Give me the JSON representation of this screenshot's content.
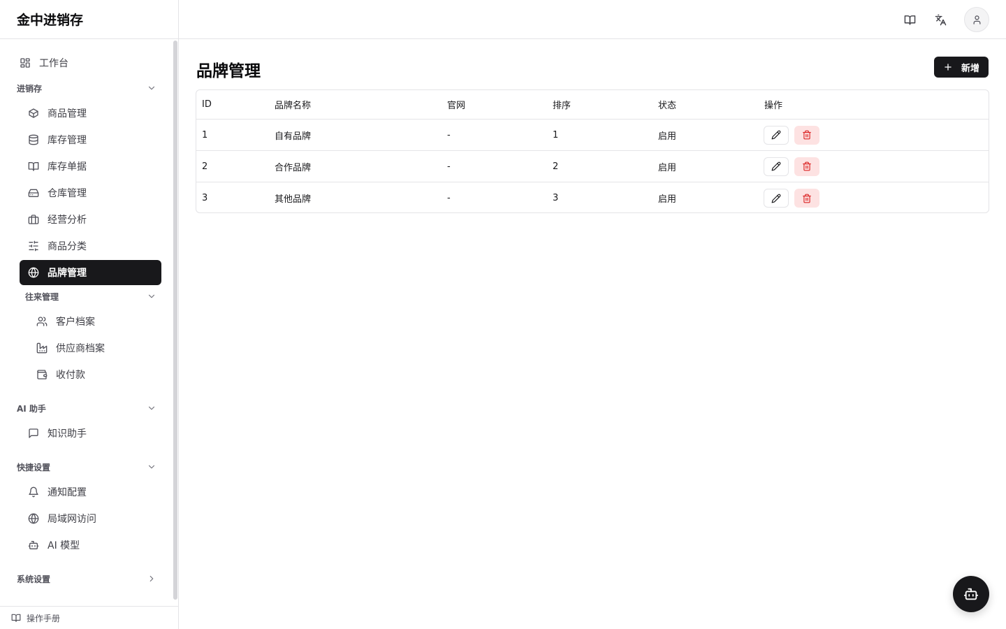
{
  "app": {
    "title": "金中进销存"
  },
  "sidebar": {
    "workbench": {
      "label": "工作台",
      "icon": "layout-grid-icon"
    },
    "groups": [
      {
        "label": "进销存",
        "expanded": true
      },
      {
        "label": "往来管理",
        "expanded": true
      },
      {
        "label": "AI 助手",
        "expanded": true
      },
      {
        "label": "快捷设置",
        "expanded": true
      },
      {
        "label": "系统设置",
        "expanded": false
      }
    ],
    "items": [
      {
        "label": "商品管理",
        "icon": "package-icon"
      },
      {
        "label": "库存管理",
        "icon": "database-icon"
      },
      {
        "label": "库存单据",
        "icon": "book-open-icon"
      },
      {
        "label": "仓库管理",
        "icon": "warehouse-icon"
      },
      {
        "label": "经营分析",
        "icon": "briefcase-icon"
      },
      {
        "label": "商品分类",
        "icon": "sliders-icon"
      },
      {
        "label": "品牌管理",
        "icon": "globe-icon",
        "active": true
      }
    ],
    "partners": [
      {
        "label": "客户档案",
        "icon": "users-icon"
      },
      {
        "label": "供应商档案",
        "icon": "factory-icon"
      },
      {
        "label": "收付款",
        "icon": "wallet-icon"
      }
    ],
    "ai": [
      {
        "label": "知识助手",
        "icon": "message-square-icon"
      }
    ],
    "quick": [
      {
        "label": "通知配置",
        "icon": "bell-icon"
      },
      {
        "label": "局域网访问",
        "icon": "globe-icon"
      },
      {
        "label": "AI 模型",
        "icon": "bot-icon"
      }
    ],
    "footer": {
      "label": "操作手册",
      "icon": "book-open-icon"
    }
  },
  "header": {
    "icons": [
      "book-open-icon",
      "languages-icon",
      "user-icon"
    ]
  },
  "main": {
    "title": "品牌管理",
    "add_label": "新增",
    "table": {
      "columns": [
        "ID",
        "品牌名称",
        "官网",
        "排序",
        "状态",
        "操作"
      ],
      "rows": [
        {
          "id": "1",
          "name": "自有品牌",
          "website": "-",
          "sort": "1",
          "status": "启用"
        },
        {
          "id": "2",
          "name": "合作品牌",
          "website": "-",
          "sort": "2",
          "status": "启用"
        },
        {
          "id": "3",
          "name": "其他品牌",
          "website": "-",
          "sort": "3",
          "status": "启用"
        }
      ]
    }
  },
  "colors": {
    "accent": "#18181b",
    "danger": "#dc2626",
    "danger_bg": "#fde2e2",
    "border": "#e4e4e7"
  }
}
